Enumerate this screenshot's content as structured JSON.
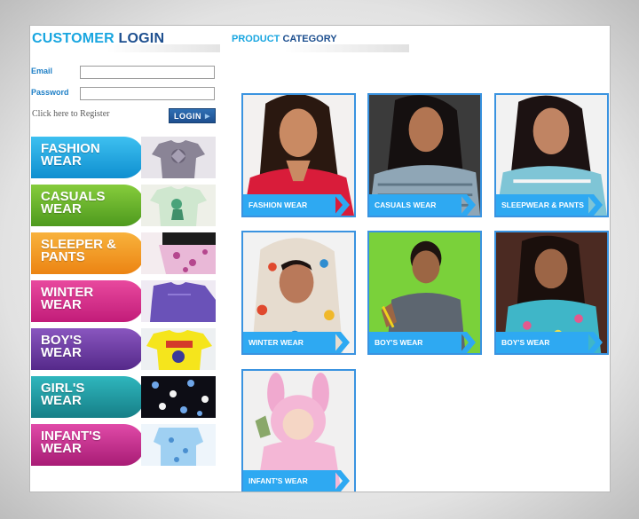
{
  "login": {
    "title_part1": "CUSTOMER",
    "title_part2": "LOGIN",
    "email_label": "Email",
    "email_value": "",
    "password_label": "Password",
    "password_value": "",
    "register_link": "Click here to Register",
    "login_button": "LOGIN"
  },
  "category": {
    "title_part1": "PRODUCT",
    "title_part2": "CATEGORY"
  },
  "side_menu": [
    {
      "line1": "FASHION",
      "line2": "WEAR",
      "color": "#19a6e0"
    },
    {
      "line1": "CASUALS",
      "line2": "WEAR",
      "color": "#6ab42b"
    },
    {
      "line1": "SLEEPER &",
      "line2": "PANTS",
      "color": "#f39a1f"
    },
    {
      "line1": "WINTER",
      "line2": "WEAR",
      "color": "#d62b8c"
    },
    {
      "line1": "BOY'S",
      "line2": "WEAR",
      "color": "#6a3a9e"
    },
    {
      "line1": "GIRL'S",
      "line2": "WEAR",
      "color": "#1d9aa3"
    },
    {
      "line1": "INFANT'S",
      "line2": "WEAR",
      "color": "#c42f8e"
    }
  ],
  "tiles": [
    {
      "caption": "FASHION WEAR"
    },
    {
      "caption": "CASUALS WEAR"
    },
    {
      "caption": "SLEEPWEAR & PANTS"
    },
    {
      "caption": "WINTER WEAR"
    },
    {
      "caption": "BOY'S WEAR"
    },
    {
      "caption": "BOY'S WEAR"
    },
    {
      "caption": "INFANT'S WEAR"
    }
  ],
  "colors": {
    "accent_light": "#19a6e0",
    "accent_dark": "#1d4f8f",
    "tile_border": "#3a93e0",
    "caption_bar": "#2ea9f2"
  }
}
